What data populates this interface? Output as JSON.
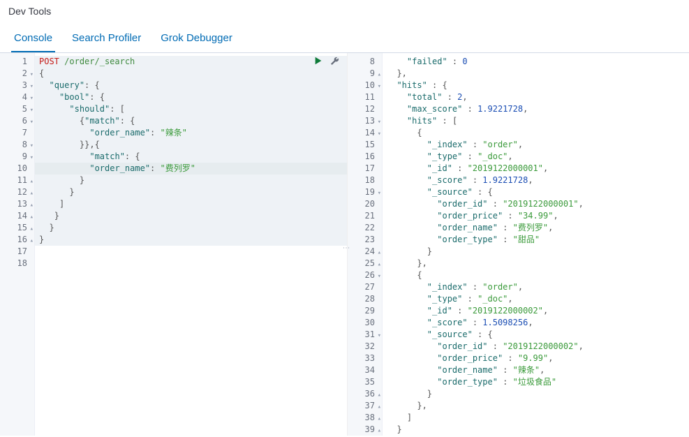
{
  "header": {
    "title": "Dev Tools"
  },
  "tabs": [
    {
      "label": "Console",
      "active": true
    },
    {
      "label": "Search Profiler",
      "active": false
    },
    {
      "label": "Grok Debugger",
      "active": false
    }
  ],
  "request": {
    "method": "POST",
    "path": "/order/_search",
    "body_lines": [
      "{",
      "  \"query\": {",
      "    \"bool\": {",
      "      \"should\": [",
      "        {\"match\": {",
      "          \"order_name\": \"辣条\"",
      "        }},{",
      "          \"match\": {",
      "          \"order_name\": \"费列罗\"",
      "        }",
      "      }",
      "    ]",
      "   }",
      "  }",
      "}"
    ],
    "highlighted_line_index": 9,
    "gutter_start": 1,
    "gutter_end": 18
  },
  "response": {
    "gutter_start": 8,
    "lines": [
      {
        "indent": 2,
        "tokens": [
          [
            "key",
            "\"failed\""
          ],
          [
            "punc",
            " : "
          ],
          [
            "num",
            "0"
          ]
        ]
      },
      {
        "indent": 1,
        "tokens": [
          [
            "punc",
            "},"
          ]
        ],
        "fold": "up"
      },
      {
        "indent": 1,
        "tokens": [
          [
            "key",
            "\"hits\""
          ],
          [
            "punc",
            " : {"
          ]
        ],
        "fold": "down"
      },
      {
        "indent": 2,
        "tokens": [
          [
            "key",
            "\"total\""
          ],
          [
            "punc",
            " : "
          ],
          [
            "num",
            "2"
          ],
          [
            "punc",
            ","
          ]
        ]
      },
      {
        "indent": 2,
        "tokens": [
          [
            "key",
            "\"max_score\""
          ],
          [
            "punc",
            " : "
          ],
          [
            "num",
            "1.9221728"
          ],
          [
            "punc",
            ","
          ]
        ]
      },
      {
        "indent": 2,
        "tokens": [
          [
            "key",
            "\"hits\""
          ],
          [
            "punc",
            " : ["
          ]
        ],
        "fold": "down"
      },
      {
        "indent": 3,
        "tokens": [
          [
            "punc",
            "{"
          ]
        ],
        "fold": "down"
      },
      {
        "indent": 4,
        "tokens": [
          [
            "key",
            "\"_index\""
          ],
          [
            "punc",
            " : "
          ],
          [
            "str",
            "\"order\""
          ],
          [
            "punc",
            ","
          ]
        ]
      },
      {
        "indent": 4,
        "tokens": [
          [
            "key",
            "\"_type\""
          ],
          [
            "punc",
            " : "
          ],
          [
            "str",
            "\"_doc\""
          ],
          [
            "punc",
            ","
          ]
        ]
      },
      {
        "indent": 4,
        "tokens": [
          [
            "key",
            "\"_id\""
          ],
          [
            "punc",
            " : "
          ],
          [
            "str",
            "\"2019122000001\""
          ],
          [
            "punc",
            ","
          ]
        ]
      },
      {
        "indent": 4,
        "tokens": [
          [
            "key",
            "\"_score\""
          ],
          [
            "punc",
            " : "
          ],
          [
            "num",
            "1.9221728"
          ],
          [
            "punc",
            ","
          ]
        ]
      },
      {
        "indent": 4,
        "tokens": [
          [
            "key",
            "\"_source\""
          ],
          [
            "punc",
            " : {"
          ]
        ],
        "fold": "down"
      },
      {
        "indent": 5,
        "tokens": [
          [
            "key",
            "\"order_id\""
          ],
          [
            "punc",
            " : "
          ],
          [
            "str",
            "\"2019122000001\""
          ],
          [
            "punc",
            ","
          ]
        ]
      },
      {
        "indent": 5,
        "tokens": [
          [
            "key",
            "\"order_price\""
          ],
          [
            "punc",
            " : "
          ],
          [
            "str",
            "\"34.99\""
          ],
          [
            "punc",
            ","
          ]
        ]
      },
      {
        "indent": 5,
        "tokens": [
          [
            "key",
            "\"order_name\""
          ],
          [
            "punc",
            " : "
          ],
          [
            "str",
            "\"费列罗\""
          ],
          [
            "punc",
            ","
          ]
        ]
      },
      {
        "indent": 5,
        "tokens": [
          [
            "key",
            "\"order_type\""
          ],
          [
            "punc",
            " : "
          ],
          [
            "str",
            "\"甜品\""
          ]
        ]
      },
      {
        "indent": 4,
        "tokens": [
          [
            "punc",
            "}"
          ]
        ],
        "fold": "up"
      },
      {
        "indent": 3,
        "tokens": [
          [
            "punc",
            "},"
          ]
        ],
        "fold": "up"
      },
      {
        "indent": 3,
        "tokens": [
          [
            "punc",
            "{"
          ]
        ],
        "fold": "down"
      },
      {
        "indent": 4,
        "tokens": [
          [
            "key",
            "\"_index\""
          ],
          [
            "punc",
            " : "
          ],
          [
            "str",
            "\"order\""
          ],
          [
            "punc",
            ","
          ]
        ]
      },
      {
        "indent": 4,
        "tokens": [
          [
            "key",
            "\"_type\""
          ],
          [
            "punc",
            " : "
          ],
          [
            "str",
            "\"_doc\""
          ],
          [
            "punc",
            ","
          ]
        ]
      },
      {
        "indent": 4,
        "tokens": [
          [
            "key",
            "\"_id\""
          ],
          [
            "punc",
            " : "
          ],
          [
            "str",
            "\"2019122000002\""
          ],
          [
            "punc",
            ","
          ]
        ]
      },
      {
        "indent": 4,
        "tokens": [
          [
            "key",
            "\"_score\""
          ],
          [
            "punc",
            " : "
          ],
          [
            "num",
            "1.5098256"
          ],
          [
            "punc",
            ","
          ]
        ]
      },
      {
        "indent": 4,
        "tokens": [
          [
            "key",
            "\"_source\""
          ],
          [
            "punc",
            " : {"
          ]
        ],
        "fold": "down"
      },
      {
        "indent": 5,
        "tokens": [
          [
            "key",
            "\"order_id\""
          ],
          [
            "punc",
            " : "
          ],
          [
            "str",
            "\"2019122000002\""
          ],
          [
            "punc",
            ","
          ]
        ]
      },
      {
        "indent": 5,
        "tokens": [
          [
            "key",
            "\"order_price\""
          ],
          [
            "punc",
            " : "
          ],
          [
            "str",
            "\"9.99\""
          ],
          [
            "punc",
            ","
          ]
        ]
      },
      {
        "indent": 5,
        "tokens": [
          [
            "key",
            "\"order_name\""
          ],
          [
            "punc",
            " : "
          ],
          [
            "str",
            "\"辣条\""
          ],
          [
            "punc",
            ","
          ]
        ]
      },
      {
        "indent": 5,
        "tokens": [
          [
            "key",
            "\"order_type\""
          ],
          [
            "punc",
            " : "
          ],
          [
            "str",
            "\"垃圾食品\""
          ]
        ]
      },
      {
        "indent": 4,
        "tokens": [
          [
            "punc",
            "}"
          ]
        ],
        "fold": "up"
      },
      {
        "indent": 3,
        "tokens": [
          [
            "punc",
            "},"
          ]
        ],
        "fold": "up"
      },
      {
        "indent": 2,
        "tokens": [
          [
            "punc",
            "]"
          ]
        ],
        "fold": "up"
      },
      {
        "indent": 1,
        "tokens": [
          [
            "punc",
            "}"
          ]
        ],
        "fold": "up"
      }
    ]
  }
}
